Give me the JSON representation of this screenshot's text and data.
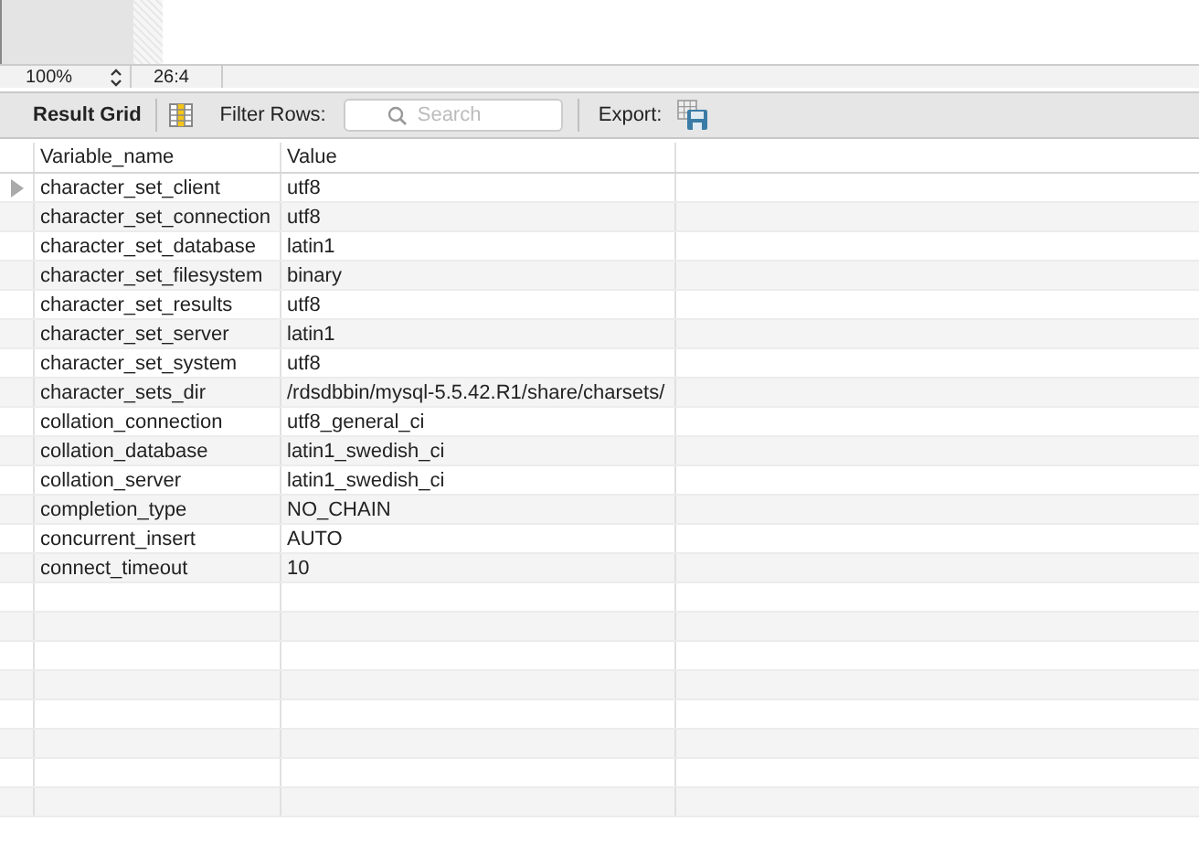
{
  "status_bar": {
    "zoom": "100%",
    "position": "26:4"
  },
  "toolbar": {
    "result_grid": "Result Grid",
    "filter_label": "Filter Rows:",
    "search": {
      "placeholder": "Search"
    },
    "export_label": "Export:"
  },
  "table": {
    "columns": [
      "Variable_name",
      "Value"
    ],
    "rows": [
      {
        "cells": [
          "character_set_client",
          "utf8"
        ],
        "selected": true
      },
      {
        "cells": [
          "character_set_connection",
          "utf8"
        ],
        "selected": false
      },
      {
        "cells": [
          "character_set_database",
          "latin1"
        ],
        "selected": false
      },
      {
        "cells": [
          "character_set_filesystem",
          "binary"
        ],
        "selected": false
      },
      {
        "cells": [
          "character_set_results",
          "utf8"
        ],
        "selected": false
      },
      {
        "cells": [
          "character_set_server",
          "latin1"
        ],
        "selected": false
      },
      {
        "cells": [
          "character_set_system",
          "utf8"
        ],
        "selected": false
      },
      {
        "cells": [
          "character_sets_dir",
          "/rdsdbbin/mysql-5.5.42.R1/share/charsets/"
        ],
        "selected": false
      },
      {
        "cells": [
          "collation_connection",
          "utf8_general_ci"
        ],
        "selected": false
      },
      {
        "cells": [
          "collation_database",
          "latin1_swedish_ci"
        ],
        "selected": false
      },
      {
        "cells": [
          "collation_server",
          "latin1_swedish_ci"
        ],
        "selected": false
      },
      {
        "cells": [
          "completion_type",
          "NO_CHAIN"
        ],
        "selected": false
      },
      {
        "cells": [
          "concurrent_insert",
          "AUTO"
        ],
        "selected": false
      },
      {
        "cells": [
          "connect_timeout",
          "10"
        ],
        "selected": false
      }
    ]
  }
}
